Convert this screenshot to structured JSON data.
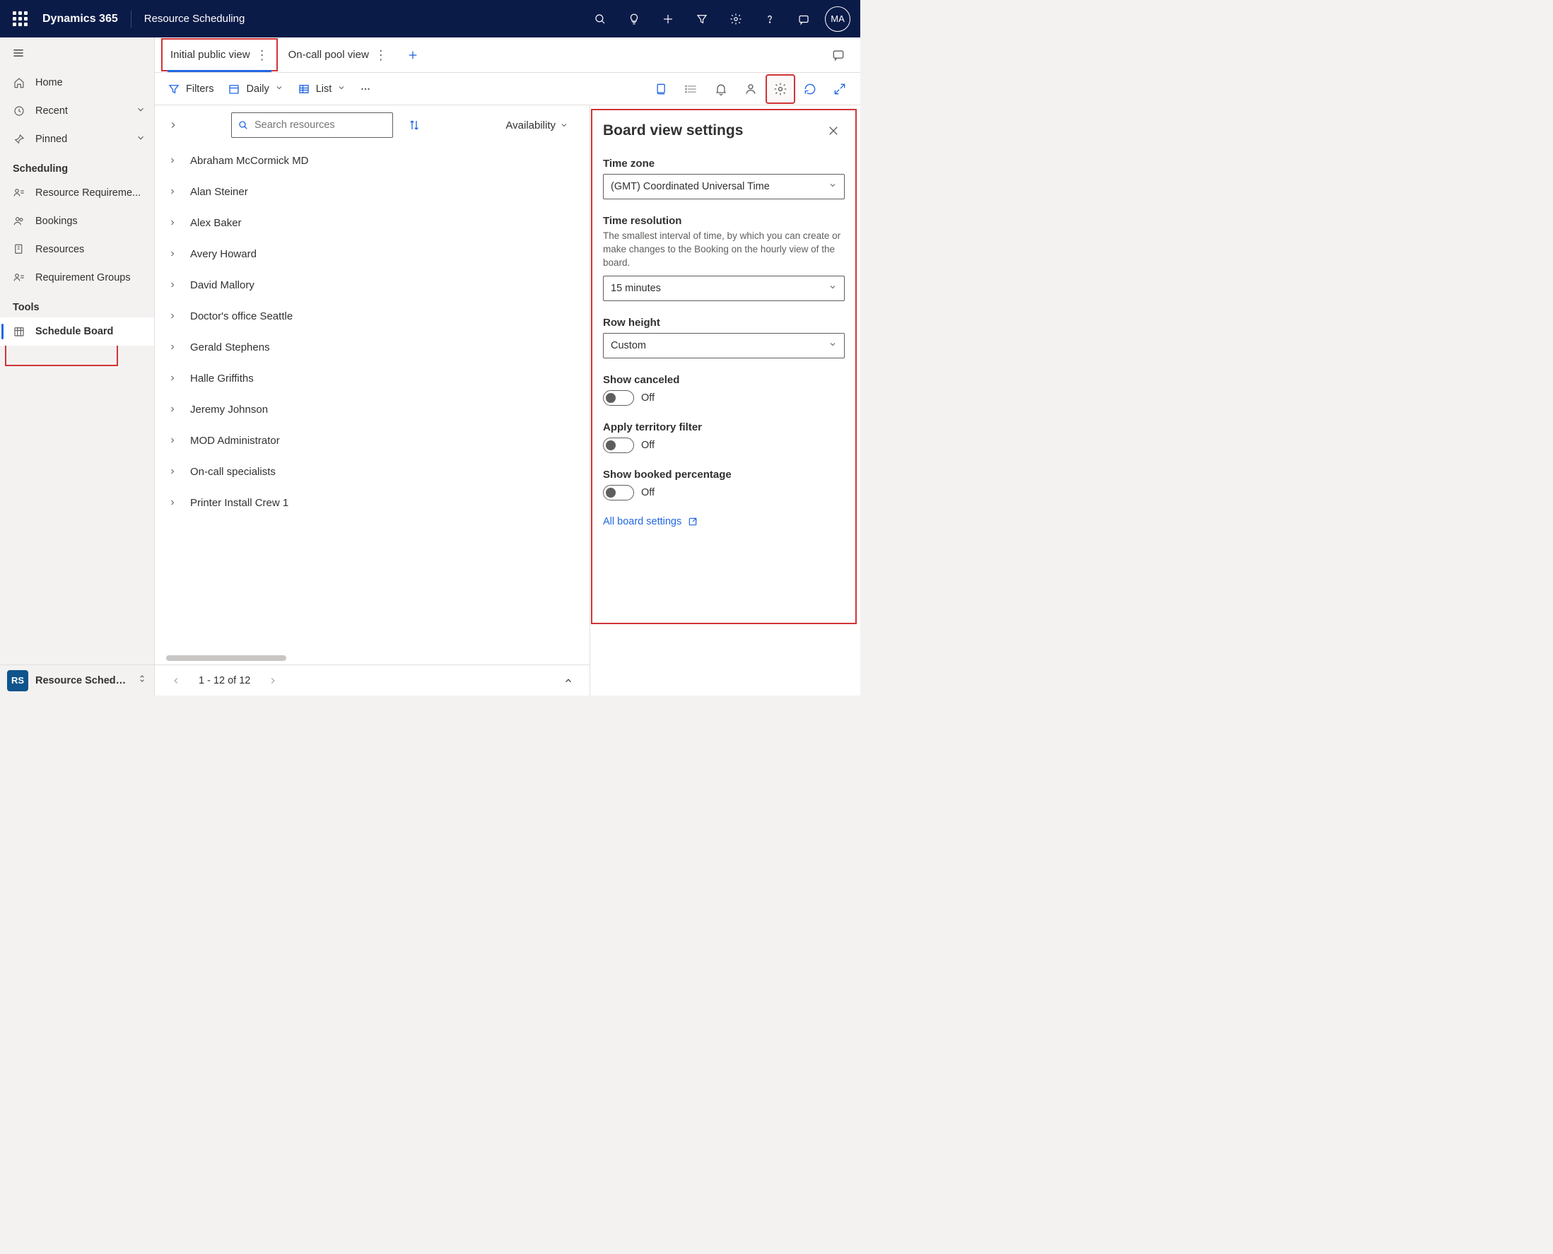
{
  "header": {
    "brand": "Dynamics 365",
    "subtitle": "Resource Scheduling",
    "avatar_initials": "MA"
  },
  "sidebar": {
    "home": "Home",
    "recent": "Recent",
    "pinned": "Pinned",
    "section_scheduling": "Scheduling",
    "resource_req": "Resource Requireme...",
    "bookings": "Bookings",
    "resources": "Resources",
    "req_groups": "Requirement Groups",
    "section_tools": "Tools",
    "schedule_board": "Schedule Board",
    "area_badge": "RS",
    "area_label": "Resource Schedul..."
  },
  "tabs": {
    "tab0": "Initial public view",
    "tab1": "On-call pool view"
  },
  "toolbar": {
    "filters": "Filters",
    "daily": "Daily",
    "list": "List"
  },
  "resourceHeader": {
    "search_placeholder": "Search resources",
    "availability": "Availability"
  },
  "resources": [
    "Abraham McCormick MD",
    "Alan Steiner",
    "Alex Baker",
    "Avery Howard",
    "David Mallory",
    "Doctor's office Seattle",
    "Gerald Stephens",
    "Halle Griffiths",
    "Jeremy Johnson",
    "MOD Administrator",
    "On-call specialists",
    "Printer Install Crew 1"
  ],
  "settings": {
    "title": "Board view settings",
    "tz_label": "Time zone",
    "tz_value": "(GMT) Coordinated Universal Time",
    "tr_label": "Time resolution",
    "tr_help": "The smallest interval of time, by which you can create or make changes to the Booking on the hourly view of the board.",
    "tr_value": "15 minutes",
    "rh_label": "Row height",
    "rh_value": "Custom",
    "sc_label": "Show canceled",
    "sc_state": "Off",
    "atf_label": "Apply territory filter",
    "atf_state": "Off",
    "sbp_label": "Show booked percentage",
    "sbp_state": "Off",
    "all_link": "All board settings"
  },
  "pager": {
    "text": "1 - 12 of 12"
  }
}
